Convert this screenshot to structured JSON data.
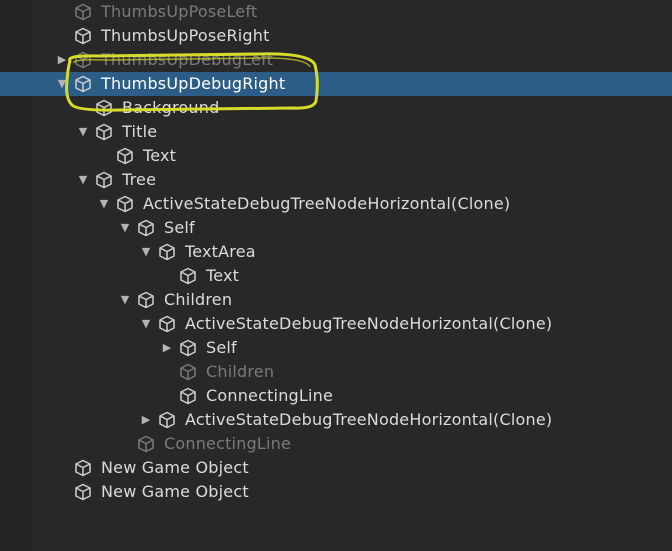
{
  "hierarchy": {
    "rows": [
      {
        "label": "ThumbsUpPoseLeft",
        "depth": 0,
        "caret": "",
        "dim": true,
        "selected": false
      },
      {
        "label": "ThumbsUpPoseRight",
        "depth": 0,
        "caret": "",
        "dim": false,
        "selected": false
      },
      {
        "label": "ThumbsUpDebugLeft",
        "depth": 0,
        "caret": "▶",
        "dim": true,
        "selected": false
      },
      {
        "label": "ThumbsUpDebugRight",
        "depth": 0,
        "caret": "▼",
        "dim": false,
        "selected": true
      },
      {
        "label": "Background",
        "depth": 1,
        "caret": "",
        "dim": false,
        "selected": false
      },
      {
        "label": "Title",
        "depth": 1,
        "caret": "▼",
        "dim": false,
        "selected": false
      },
      {
        "label": "Text",
        "depth": 2,
        "caret": "",
        "dim": false,
        "selected": false
      },
      {
        "label": "Tree",
        "depth": 1,
        "caret": "▼",
        "dim": false,
        "selected": false
      },
      {
        "label": "ActiveStateDebugTreeNodeHorizontal(Clone)",
        "depth": 2,
        "caret": "▼",
        "dim": false,
        "selected": false
      },
      {
        "label": "Self",
        "depth": 3,
        "caret": "▼",
        "dim": false,
        "selected": false
      },
      {
        "label": "TextArea",
        "depth": 4,
        "caret": "▼",
        "dim": false,
        "selected": false
      },
      {
        "label": "Text",
        "depth": 5,
        "caret": "",
        "dim": false,
        "selected": false
      },
      {
        "label": "Children",
        "depth": 3,
        "caret": "▼",
        "dim": false,
        "selected": false
      },
      {
        "label": "ActiveStateDebugTreeNodeHorizontal(Clone)",
        "depth": 4,
        "caret": "▼",
        "dim": false,
        "selected": false
      },
      {
        "label": "Self",
        "depth": 5,
        "caret": "▶",
        "dim": false,
        "selected": false
      },
      {
        "label": "Children",
        "depth": 5,
        "caret": "",
        "dim": true,
        "selected": false
      },
      {
        "label": "ConnectingLine",
        "depth": 5,
        "caret": "",
        "dim": false,
        "selected": false
      },
      {
        "label": "ActiveStateDebugTreeNodeHorizontal(Clone)",
        "depth": 4,
        "caret": "▶",
        "dim": false,
        "selected": false
      },
      {
        "label": "ConnectingLine",
        "depth": 3,
        "caret": "",
        "dim": true,
        "selected": false
      },
      {
        "label": "New Game Object",
        "depth": 0,
        "caret": "",
        "dim": false,
        "selected": false
      },
      {
        "label": "New Game Object",
        "depth": 0,
        "caret": "",
        "dim": false,
        "selected": false
      }
    ]
  },
  "icons": {
    "row_icon": "gameobject-cube-icon",
    "expand_icon": "caret-right-icon",
    "collapse_icon": "caret-down-icon"
  },
  "colors": {
    "background": "#282828",
    "selection": "#2c5d87",
    "text": "#dcdcdc",
    "text_dim": "#7a7a7a",
    "annotation": "#d6dc2a"
  }
}
